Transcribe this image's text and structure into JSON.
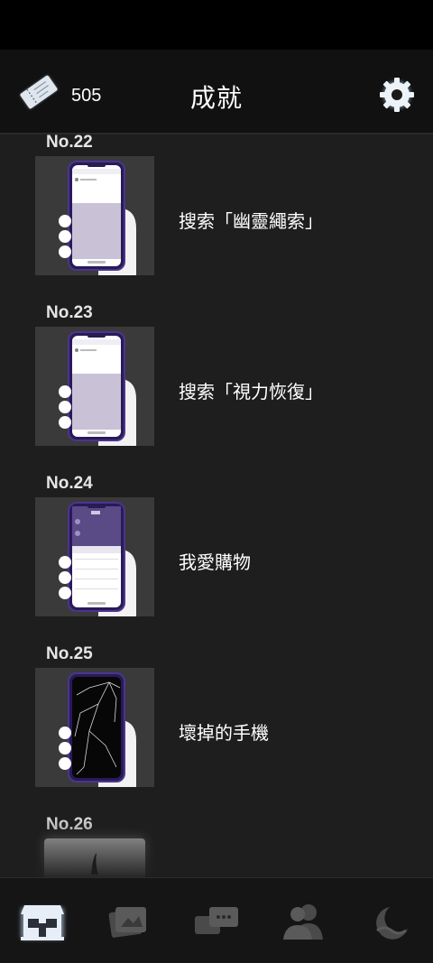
{
  "header": {
    "ticket_count": "505",
    "title": "成就"
  },
  "achievements": [
    {
      "number": "No.22",
      "label": "搜索「幽靈繩索」"
    },
    {
      "number": "No.23",
      "label": "搜索「視力恢復」"
    },
    {
      "number": "No.24",
      "label": "我愛購物"
    },
    {
      "number": "No.25",
      "label": "壞掉的手機"
    },
    {
      "number": "No.26",
      "label": ""
    }
  ],
  "nav": {
    "items": [
      {
        "icon": "shop-icon",
        "active": true
      },
      {
        "icon": "album-icon",
        "active": false
      },
      {
        "icon": "messages-icon",
        "active": false
      },
      {
        "icon": "characters-icon",
        "active": false
      },
      {
        "icon": "moon-icon",
        "active": false
      }
    ]
  },
  "colors": {
    "background": "#1e1e1e",
    "header": "#111111",
    "phone_frame": "#3b2a6b",
    "accent_active": "#e8eef8"
  }
}
